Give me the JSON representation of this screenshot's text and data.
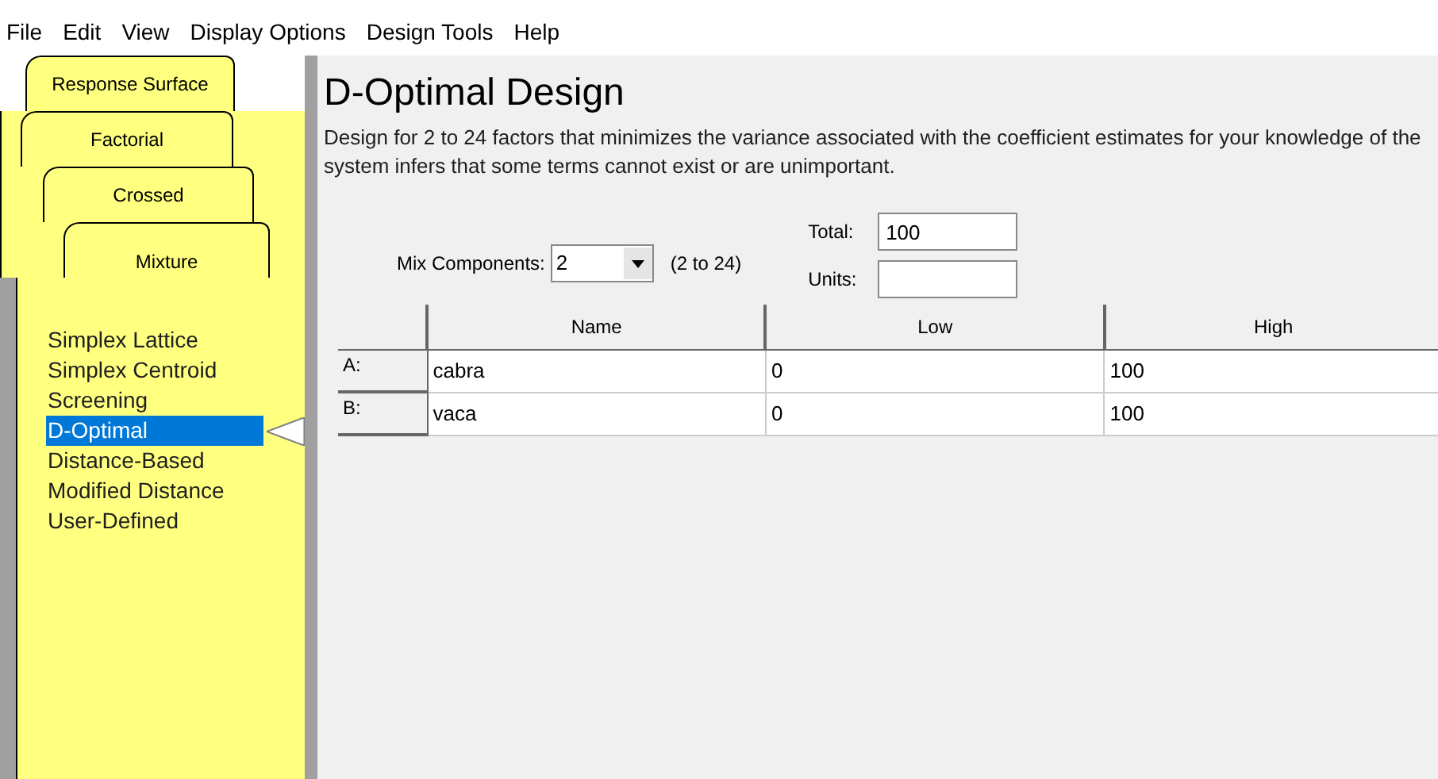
{
  "menu": [
    "File",
    "Edit",
    "View",
    "Display Options",
    "Design Tools",
    "Help"
  ],
  "tabs": [
    {
      "label": "Response Surface",
      "selected": false
    },
    {
      "label": "Factorial",
      "selected": false
    },
    {
      "label": "Crossed",
      "selected": false
    },
    {
      "label": "Mixture",
      "selected": true
    }
  ],
  "designs": [
    {
      "label": "Simplex Lattice",
      "selected": false
    },
    {
      "label": "Simplex Centroid",
      "selected": false
    },
    {
      "label": "Screening",
      "selected": false
    },
    {
      "label": "D-Optimal",
      "selected": true
    },
    {
      "label": "Distance-Based",
      "selected": false
    },
    {
      "label": "Modified Distance",
      "selected": false
    },
    {
      "label": "User-Defined",
      "selected": false
    }
  ],
  "title": "D-Optimal Design",
  "description": "Design for 2 to 24 factors that minimizes the variance associated with the coefficient estimates for your knowledge of the system infers that some terms cannot exist or are unimportant.",
  "mix_components": {
    "label": "Mix Components:",
    "value": "2",
    "range": "(2 to 24)"
  },
  "total": {
    "label": "Total:",
    "value": "100"
  },
  "units": {
    "label": "Units:"
  },
  "table": {
    "columns": [
      "Name",
      "Low",
      "High"
    ],
    "rows": [
      {
        "label": "A:",
        "cells": [
          "cabra",
          "0",
          "100"
        ]
      },
      {
        "label": "B:",
        "cells": [
          "vaca",
          "0",
          "100"
        ]
      }
    ]
  }
}
